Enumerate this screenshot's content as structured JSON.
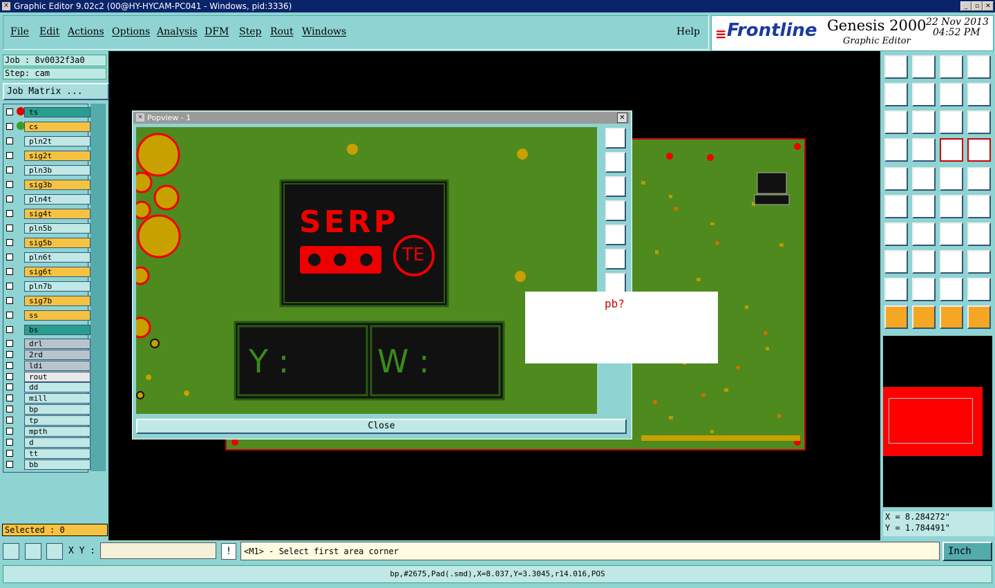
{
  "window": {
    "title": "Graphic Editor 9.02c2 (00@HY-HYCAM-PC041 - Windows, pid:3336)",
    "controls": [
      "_",
      "▫",
      "✕"
    ]
  },
  "menu": {
    "items": [
      "File",
      "Edit",
      "Actions",
      "Options",
      "Analysis",
      "DFM",
      "Step",
      "Rout",
      "Windows"
    ],
    "help": "Help"
  },
  "brand": {
    "logo": "Frontline",
    "product": "Genesis 2000",
    "subtitle": "Graphic Editor",
    "date": "22 Nov 2013",
    "time": "04:52 PM"
  },
  "left": {
    "job": "Job : 8v0032f3a0",
    "step": "Step: cam",
    "job_matrix": "Job Matrix ...",
    "layers": [
      {
        "name": "ts",
        "color": "#2a9d8f",
        "dot": "#e00000"
      },
      {
        "name": "cs",
        "color": "#f5c242",
        "dot": "#3a9a2a"
      },
      {
        "name": "pln2t",
        "color": "#bfe8e6"
      },
      {
        "name": "sig2t",
        "color": "#f5c242"
      },
      {
        "name": "pln3b",
        "color": "#bfe8e6"
      },
      {
        "name": "sig3b",
        "color": "#f5c242"
      },
      {
        "name": "pln4t",
        "color": "#bfe8e6"
      },
      {
        "name": "sig4t",
        "color": "#f5c242"
      },
      {
        "name": "pln5b",
        "color": "#bfe8e6"
      },
      {
        "name": "sig5b",
        "color": "#f5c242"
      },
      {
        "name": "pln6t",
        "color": "#bfe8e6"
      },
      {
        "name": "sig6t",
        "color": "#f5c242"
      },
      {
        "name": "pln7b",
        "color": "#bfe8e6"
      },
      {
        "name": "sig7b",
        "color": "#f5c242"
      },
      {
        "name": "ss",
        "color": "#f5c242"
      },
      {
        "name": "bs",
        "color": "#2a9d8f"
      },
      {
        "name": "drl",
        "color": "#b8c4cc"
      },
      {
        "name": "2rd",
        "color": "#b8c4cc"
      },
      {
        "name": "ldi",
        "color": "#b8c4cc"
      },
      {
        "name": "rout",
        "color": "#e8e8e8"
      },
      {
        "name": "dd",
        "color": "#bfe8e6"
      },
      {
        "name": "mill",
        "color": "#bfe8e6"
      },
      {
        "name": "bp",
        "color": "#bfe8e6"
      },
      {
        "name": "tp",
        "color": "#bfe8e6"
      },
      {
        "name": "mpth",
        "color": "#bfe8e6"
      },
      {
        "name": "d",
        "color": "#bfe8e6"
      },
      {
        "name": "tt",
        "color": "#bfe8e6"
      },
      {
        "name": "bb",
        "color": "#bfe8e6"
      }
    ],
    "selected": "Selected : 0"
  },
  "popview": {
    "title": "Popview - 1",
    "close": "Close",
    "logo_text": "SERP",
    "logo_badge": "TE",
    "field_y": "Y :",
    "field_w": "W :"
  },
  "dialog": {
    "text": "pb?"
  },
  "right": {
    "coord_x": "X = 8.284272\"",
    "coord_y": "Y = 1.784491\""
  },
  "bottom": {
    "xy_label": "X Y :",
    "xy_value": "",
    "bang": "!",
    "prompt": "<M1> - Select first area corner",
    "unit": "Inch",
    "status": "bp,#2675,Pad(.smd),X=8.037,Y=3.3045,r14.016,POS"
  }
}
